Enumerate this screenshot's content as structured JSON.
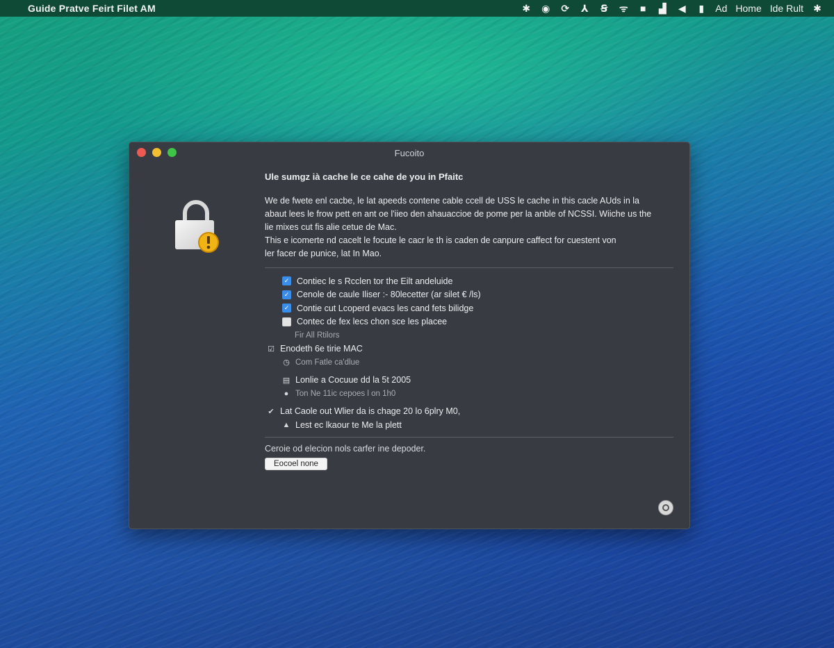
{
  "menubar": {
    "app_title": "Guide Pratve  Feirt Filet AM",
    "status_icons": [
      "bluetooth-icon",
      "time-machine-icon",
      "sync-icon",
      "accessibility-icon",
      "text-icon",
      "wifi-icon",
      "display-icon",
      "signal-icon",
      "volume-icon",
      "battery-icon"
    ],
    "item_ad": "Ad",
    "item_home": "Home",
    "item_user": "Ide Rult"
  },
  "window": {
    "title": "Fucoito",
    "heading": "Ule sumgz ià cache le ce cahe de you in Pfaitc",
    "paragraph_lines": [
      "We de fwete enl cacbe, le lat apeeds contene cable ccell de USS le cache in this cacle AUds in la",
      "abaut lees le frow pett en ant oe l'iieo den ahauaccioe de pome per la anble of NCSSI. Wiiche us the",
      "lie mixes cut fis alie cetue de Mac.",
      "This e icomerte nd cacelt le focute le cacr le th is caden de canpure caffect for cuestent von",
      "ler facer de punice, lat In Mao."
    ],
    "options": [
      {
        "label": "Contiec le s Rcclen tor the Eilt andeluide",
        "checked": true
      },
      {
        "label": "Cenole de caule Iliser :- 80lecetter (ar silet € /ls)",
        "checked": true
      },
      {
        "label": "Contie cut Lcoperd evacs les cand fets bilidge",
        "checked": true
      },
      {
        "label": "Contec de fex lecs chon sce les placee",
        "checked": false
      }
    ],
    "options_note": "Fir All Rtilors",
    "group1_label": "Enodeth 6e tirie MAC",
    "group1_sub": "Com Fatle ca'dlue",
    "group2_label": "Lonlie a Cocuue dd la 5t 2005",
    "group2_sub": "Ton Ne 11ic cepoes l on 1h0",
    "check_item": "Lat Caole out Wlier da is chage 20 lo 6plry M0,",
    "warning_item": "Lest ec lkaour te Me la plett",
    "footer_text": "Ceroie od elecion nols carfer ine depoder.",
    "footer_button": "Eocoel none"
  }
}
